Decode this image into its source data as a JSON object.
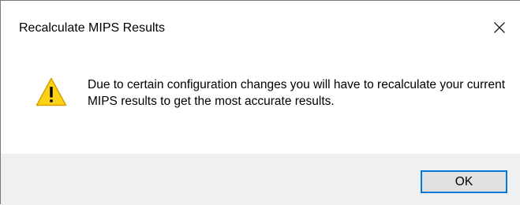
{
  "dialog": {
    "title": "Recalculate MIPS Results",
    "close_icon": "close-icon",
    "message_icon": "warning-icon",
    "message": "Due to certain configuration changes you will have to recalculate your current MIPS results to get the most accurate results.",
    "ok_label": "OK"
  },
  "colors": {
    "footer_background": "#f0f0f0",
    "button_background": "#e1e1e1",
    "button_focus_border": "#0078d7",
    "warning_fill": "#fcd116",
    "warning_stroke": "#d8a200"
  }
}
